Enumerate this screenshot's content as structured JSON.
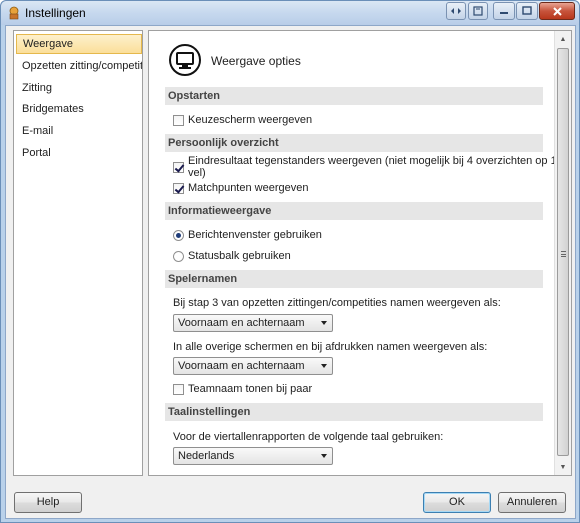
{
  "window": {
    "title": "Instellingen"
  },
  "nav": {
    "items": [
      {
        "label": "Weergave",
        "selected": true
      },
      {
        "label": "Opzetten zitting/competitie",
        "selected": false
      },
      {
        "label": "Zitting",
        "selected": false
      },
      {
        "label": "Bridgemates",
        "selected": false
      },
      {
        "label": "E-mail",
        "selected": false
      },
      {
        "label": "Portal",
        "selected": false
      }
    ]
  },
  "main": {
    "header_title": "Weergave opties",
    "sections": {
      "opstarten": "Opstarten",
      "persoonlijk": "Persoonlijk overzicht",
      "informatie": "Informatieweergave",
      "spelernamen": "Spelernamen",
      "taal": "Taalinstellingen"
    },
    "options": {
      "keuzescherm": {
        "label": "Keuzescherm weergeven",
        "checked": false
      },
      "eindresultaat": {
        "label": "Eindresultaat tegenstanders weergeven (niet mogelijk bij 4 overzichten op 1 vel)",
        "checked": true
      },
      "matchpunten": {
        "label": "Matchpunten weergeven",
        "checked": true
      },
      "berichtenvenster": {
        "label": "Berichtenvenster gebruiken",
        "checked": true
      },
      "statusbalk": {
        "label": "Statusbalk gebruiken",
        "checked": false
      },
      "teamnaam": {
        "label": "Teamnaam tonen bij paar",
        "checked": false
      }
    },
    "spelernamen_stap3_label": "Bij stap 3 van opzetten zittingen/competities namen weergeven als:",
    "spelernamen_stap3_value": "Voornaam en achternaam",
    "spelernamen_overig_label": "In alle overige schermen en bij afdrukken namen weergeven als:",
    "spelernamen_overig_value": "Voornaam en achternaam",
    "taal_label": "Voor de viertallenrapporten de volgende taal gebruiken:",
    "taal_value": "Nederlands"
  },
  "footer": {
    "help": "Help",
    "ok": "OK",
    "cancel": "Annuleren"
  }
}
